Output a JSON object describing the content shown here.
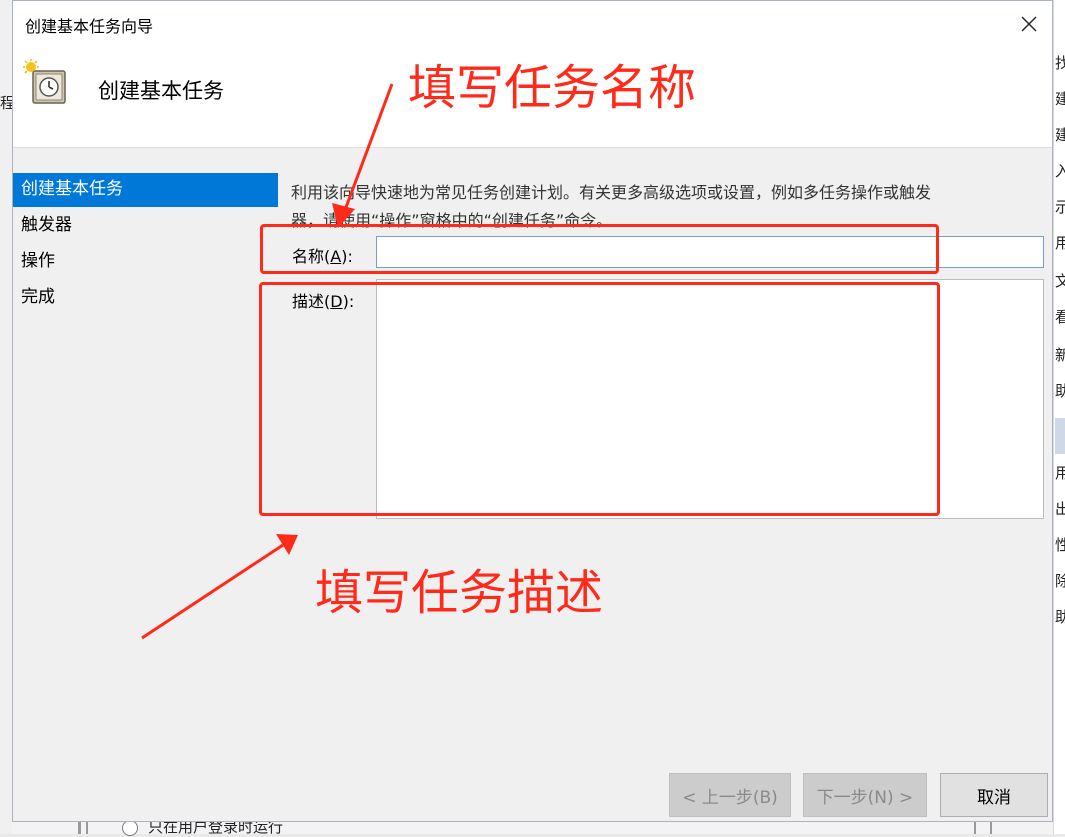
{
  "window": {
    "title": "创建基本任务向导",
    "header_title": "创建基本任务"
  },
  "nav": {
    "items": [
      {
        "label": "创建基本任务",
        "active": true
      },
      {
        "label": "触发器",
        "active": false
      },
      {
        "label": "操作",
        "active": false
      },
      {
        "label": "完成",
        "active": false
      }
    ]
  },
  "content": {
    "description_line1": "利用该向导快速地为常见任务创建计划。有关更多高级选项或设置，例如多任务操作或触发",
    "description_line2": "器，请使用“操作”窗格中的“创建任务”命令。",
    "name_label": "名称",
    "name_hotkey": "A",
    "name_value": "",
    "desc_label": "描述",
    "desc_hotkey": "D",
    "desc_value": ""
  },
  "buttons": {
    "back": "< 上一步(B)",
    "next": "下一步(N) >",
    "cancel": "取消"
  },
  "annotations": {
    "name_note": "填写任务名称",
    "desc_note": "填写任务描述",
    "color": "#ff2a1a"
  },
  "background": {
    "left_item": "程",
    "right_items": [
      "找",
      "建",
      "建",
      "入",
      "示",
      "用",
      "文",
      "看",
      "新",
      "助",
      "用",
      "出",
      "性",
      "除",
      "助"
    ],
    "bottom_option": "只在用户登录时运行"
  },
  "icons": {
    "close": "close-icon",
    "task": "task-scheduler-clock-icon"
  }
}
